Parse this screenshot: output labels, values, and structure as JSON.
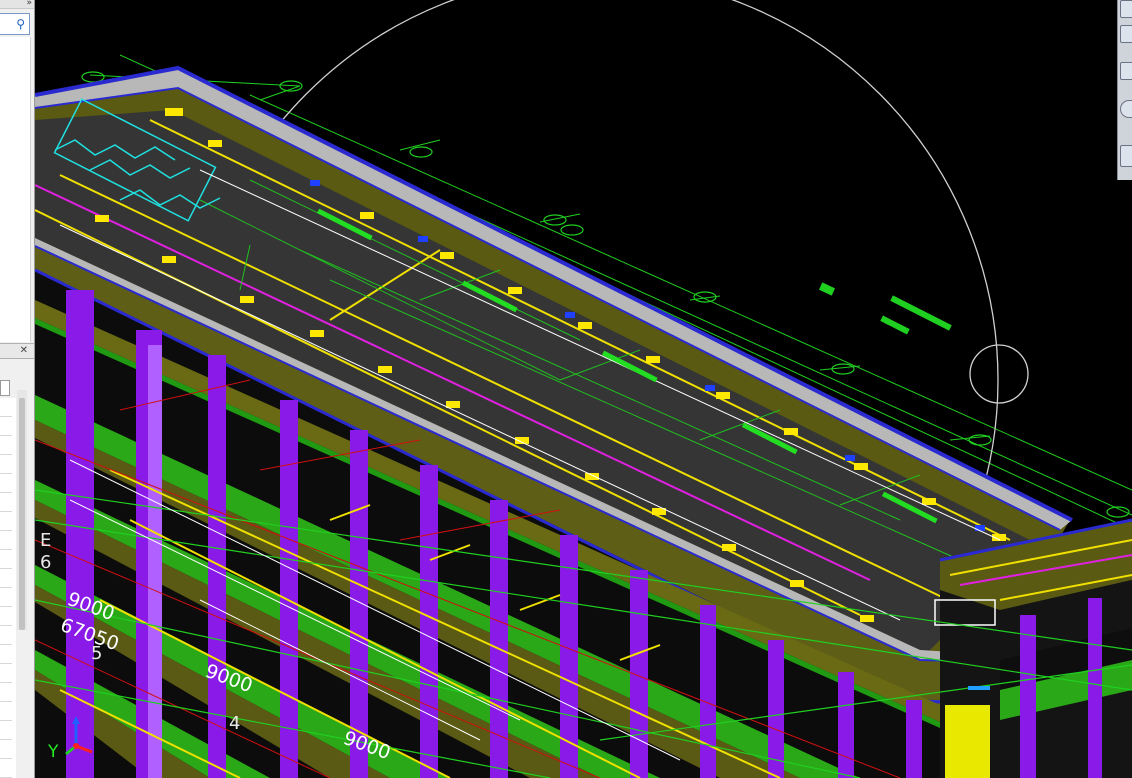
{
  "left_panel": {
    "expand_icon": "double-chevron-right-icon",
    "search_icon": "search-icon",
    "close_icon": "close-icon"
  },
  "viewport": {
    "dimensions": [
      {
        "key": "d1",
        "text": "9000"
      },
      {
        "key": "d2",
        "text": "67050"
      },
      {
        "key": "d3",
        "text": "9000"
      },
      {
        "key": "d4",
        "text": "9000"
      }
    ],
    "axis_labels": [
      {
        "key": "a1",
        "text": "5"
      },
      {
        "key": "a2",
        "text": "4"
      },
      {
        "key": "a3",
        "text": "E"
      },
      {
        "key": "a4",
        "text": "6"
      }
    ],
    "ucs": {
      "y_label": "Y"
    },
    "colors": {
      "background": "#000000",
      "slab": "#5a5a12",
      "parapet_top": "#b8b8b8",
      "parapet_edge": "#2a2ad0",
      "columns": "#8a1ae8",
      "floor_edges": "#2ec21e",
      "axis_lines": "#20d020",
      "grid_red": "#d01010",
      "highlight_yellow": "#f0e000",
      "magenta": "#e020e0",
      "cyan": "#20e0e0"
    }
  },
  "right_toolbar": {
    "icons": [
      "front-view-icon",
      "top-view-icon",
      "side-view-icon",
      "orbit-icon",
      "layout-icon"
    ]
  }
}
